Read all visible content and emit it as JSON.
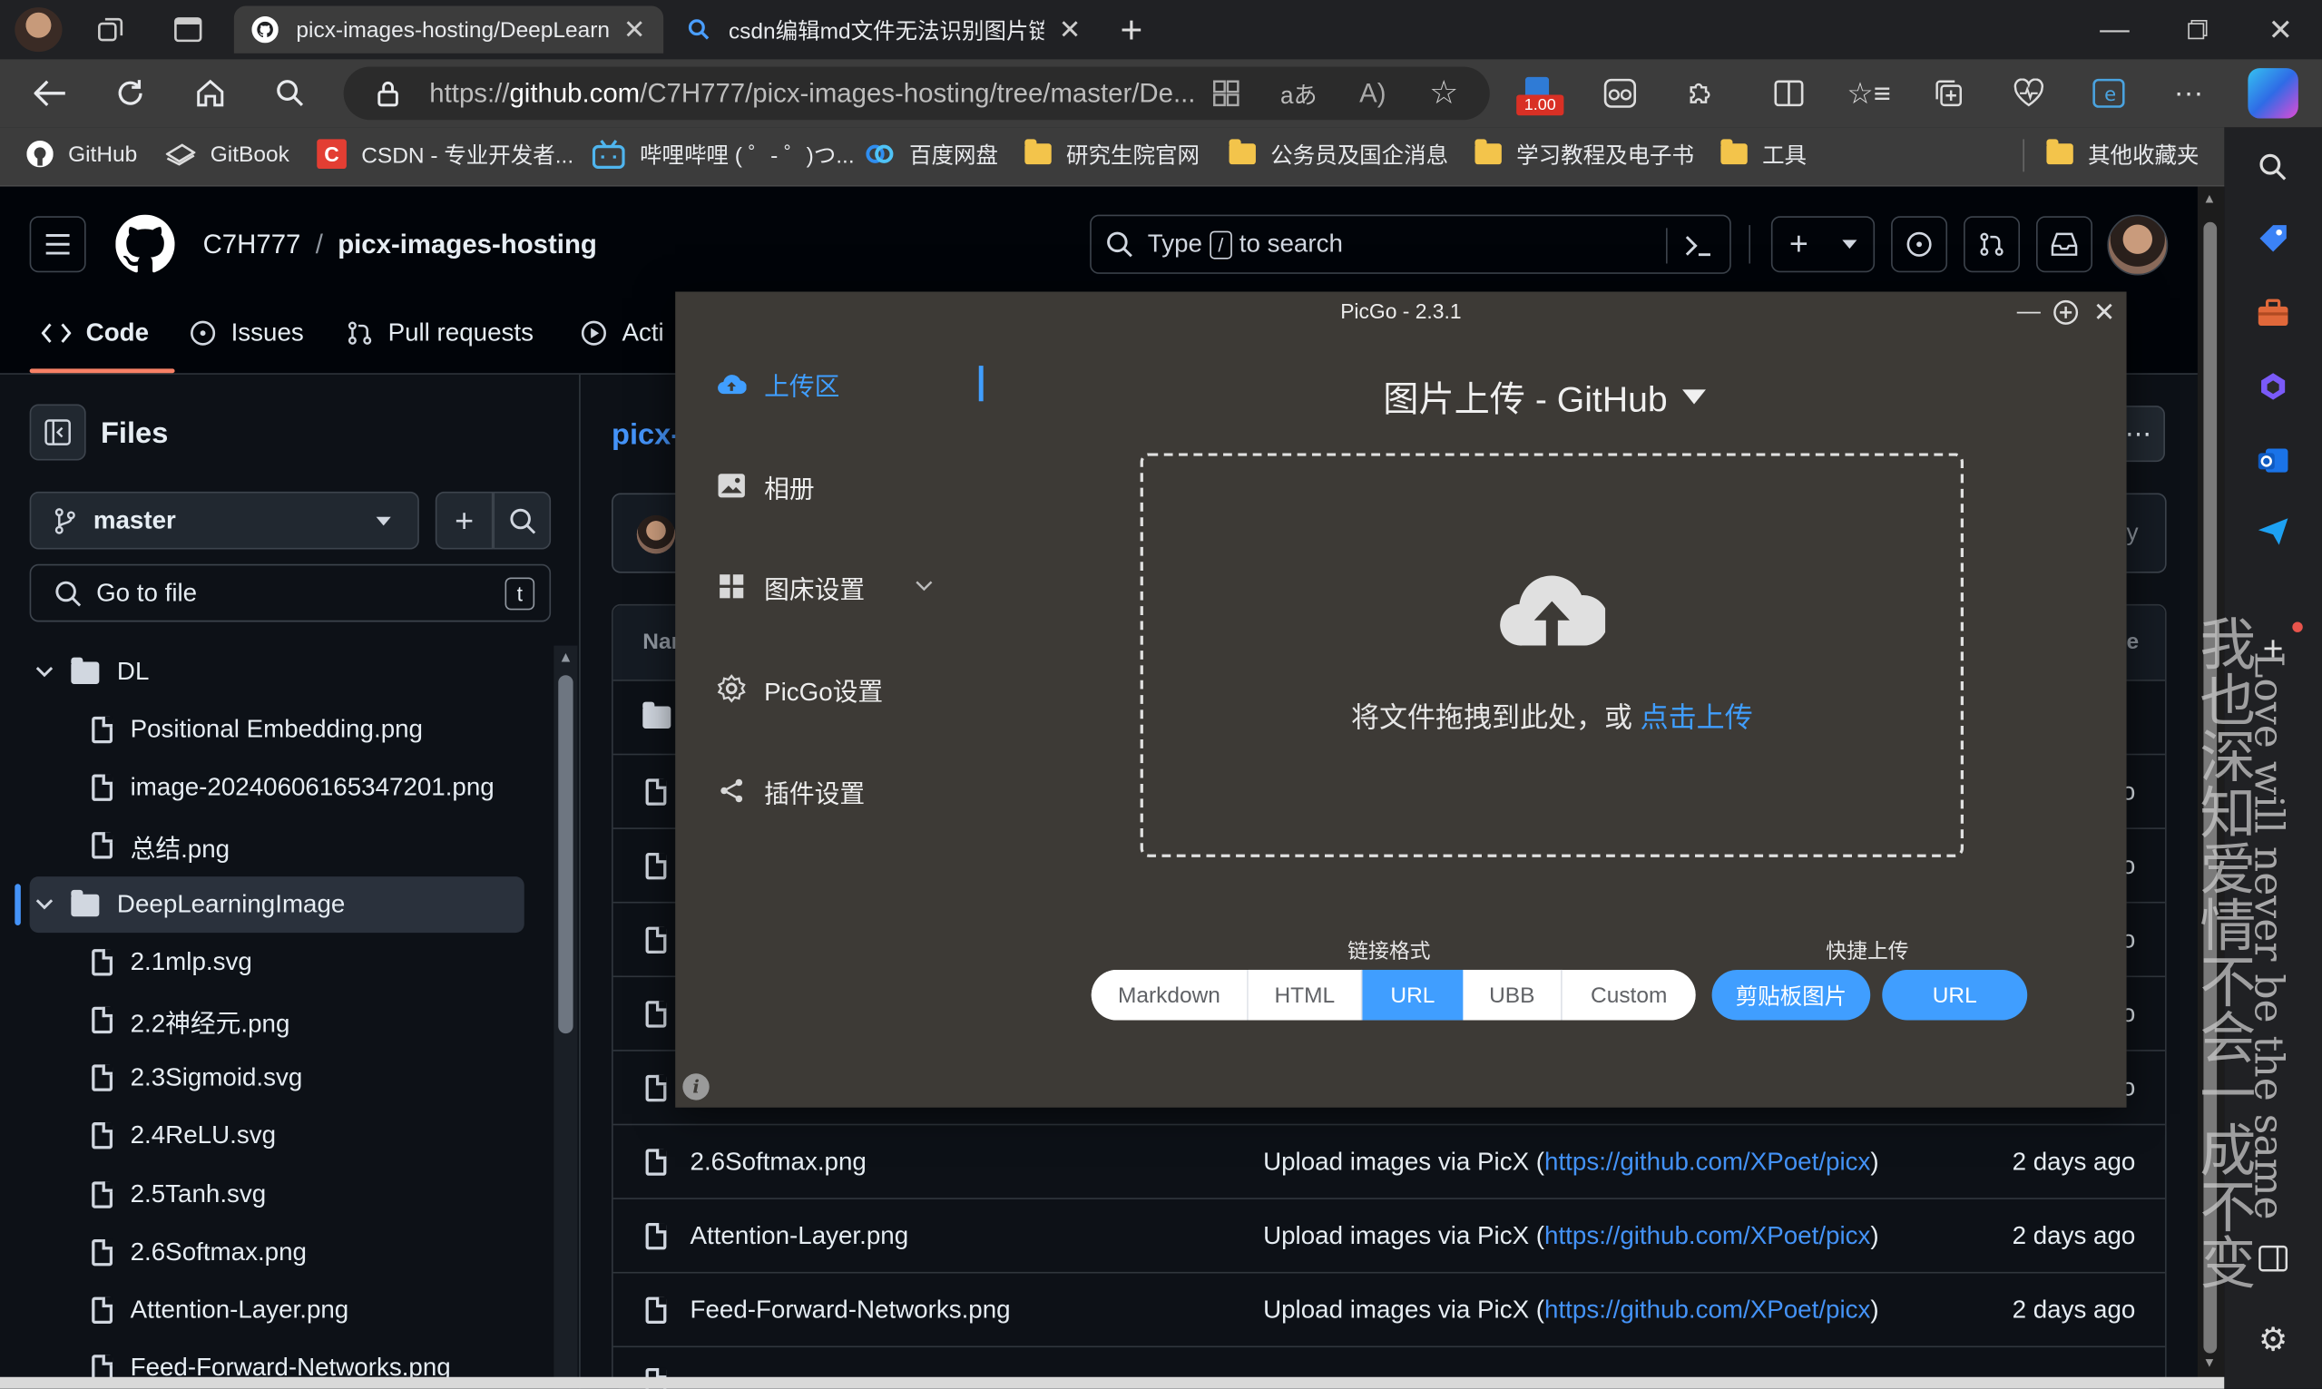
{
  "browser": {
    "tabs": [
      {
        "title": "picx-images-hosting/DeepLearni"
      },
      {
        "title": "csdn编辑md文件无法识别图片链"
      }
    ],
    "url_prefix": "https://",
    "url_host": "github.com",
    "url_path": "/C7H777/picx-images-hosting/tree/master/De...",
    "extension_badge": "1.00",
    "favorites": [
      {
        "label": "GitHub",
        "icon": "github-icon"
      },
      {
        "label": "GitBook",
        "icon": "gitbook-icon"
      },
      {
        "label": "CSDN - 专业开发者...",
        "icon": "csdn-icon"
      },
      {
        "label": "哔哩哔哩 ( ゜- ゜)つ...",
        "icon": "bilibili-icon"
      },
      {
        "label": "百度网盘",
        "icon": "baidu-netdisk-icon"
      },
      {
        "label": "研究生院官网",
        "icon": "folder-icon"
      },
      {
        "label": "公务员及国企消息",
        "icon": "folder-icon"
      },
      {
        "label": "学习教程及电子书",
        "icon": "folder-icon"
      },
      {
        "label": "工具",
        "icon": "folder-icon"
      },
      {
        "label": "其他收藏夹",
        "icon": "folder-icon"
      }
    ]
  },
  "github": {
    "owner": "C7H777",
    "separator": "/",
    "repo": "picx-images-hosting",
    "search_pre": "Type",
    "search_key": "/",
    "search_post": "to search",
    "repo_tabs": [
      "Code",
      "Issues",
      "Pull requests",
      "Acti"
    ],
    "files_title": "Files",
    "branch": "master",
    "go_to_file": "Go to file",
    "go_to_file_key": "t",
    "path_partial": "picx-",
    "table_header_partial": "Nar",
    "table_header_right_partial": "e",
    "tree": [
      {
        "name": "DL",
        "type": "dir",
        "level": 0,
        "expanded": true
      },
      {
        "name": "Positional Embedding.png",
        "type": "file",
        "level": 1
      },
      {
        "name": "image-20240606165347201.png",
        "type": "file",
        "level": 1
      },
      {
        "name": "总结.png",
        "type": "file",
        "level": 1
      },
      {
        "name": "DeepLearningImage",
        "type": "dir",
        "level": 0,
        "expanded": true,
        "selected": true
      },
      {
        "name": "2.1mlp.svg",
        "type": "file",
        "level": 1
      },
      {
        "name": "2.2神经元.png",
        "type": "file",
        "level": 1
      },
      {
        "name": "2.3Sigmoid.svg",
        "type": "file",
        "level": 1
      },
      {
        "name": "2.4ReLU.svg",
        "type": "file",
        "level": 1
      },
      {
        "name": "2.5Tanh.svg",
        "type": "file",
        "level": 1
      },
      {
        "name": "2.6Softmax.png",
        "type": "file",
        "level": 1
      },
      {
        "name": "Attention-Layer.png",
        "type": "file",
        "level": 1
      },
      {
        "name": "Feed-Forward-Networks.png",
        "type": "file",
        "level": 1
      }
    ],
    "rows": [
      {
        "name": "2.6Softmax.png",
        "msg_pre": "Upload images via PicX (",
        "link": "https://github.com/XPoet/picx",
        "msg_post": ")",
        "date": "2 days ago"
      },
      {
        "name": "Attention-Layer.png",
        "msg_pre": "Upload images via PicX (",
        "link": "https://github.com/XPoet/picx",
        "msg_post": ")",
        "date": "2 days ago"
      },
      {
        "name": "Feed-Forward-Networks.png",
        "msg_pre": "Upload images via PicX (",
        "link": "https://github.com/XPoet/picx",
        "msg_post": ")",
        "date": "2 days ago"
      }
    ],
    "partial_row_dates": [
      "o",
      "o",
      "o",
      "o",
      "o"
    ]
  },
  "picgo": {
    "window_title": "PicGo - 2.3.1",
    "menu": [
      {
        "label": "上传区",
        "icon": "cloud-upload-icon",
        "active": true
      },
      {
        "label": "相册",
        "icon": "image-icon"
      },
      {
        "label": "图床设置",
        "icon": "grid-icon",
        "has_arrow": true
      },
      {
        "label": "PicGo设置",
        "icon": "settings-icon"
      },
      {
        "label": "插件设置",
        "icon": "share-icon"
      }
    ],
    "heading": "图片上传 - GitHub",
    "drop_text": "将文件拖拽到此处，或",
    "drop_link": "点击上传",
    "link_format_label": "链接格式",
    "link_formats": [
      "Markdown",
      "HTML",
      "URL",
      "UBB",
      "Custom"
    ],
    "selected_format": "URL",
    "quick_upload_label": "快捷上传",
    "quick_buttons": [
      "剪贴板图片",
      "URL"
    ],
    "accent": "#409eff"
  },
  "overlay": {
    "vertical_cn": "我也深知爱情不会一成不变",
    "vertical_en": "Love will never be the same"
  }
}
